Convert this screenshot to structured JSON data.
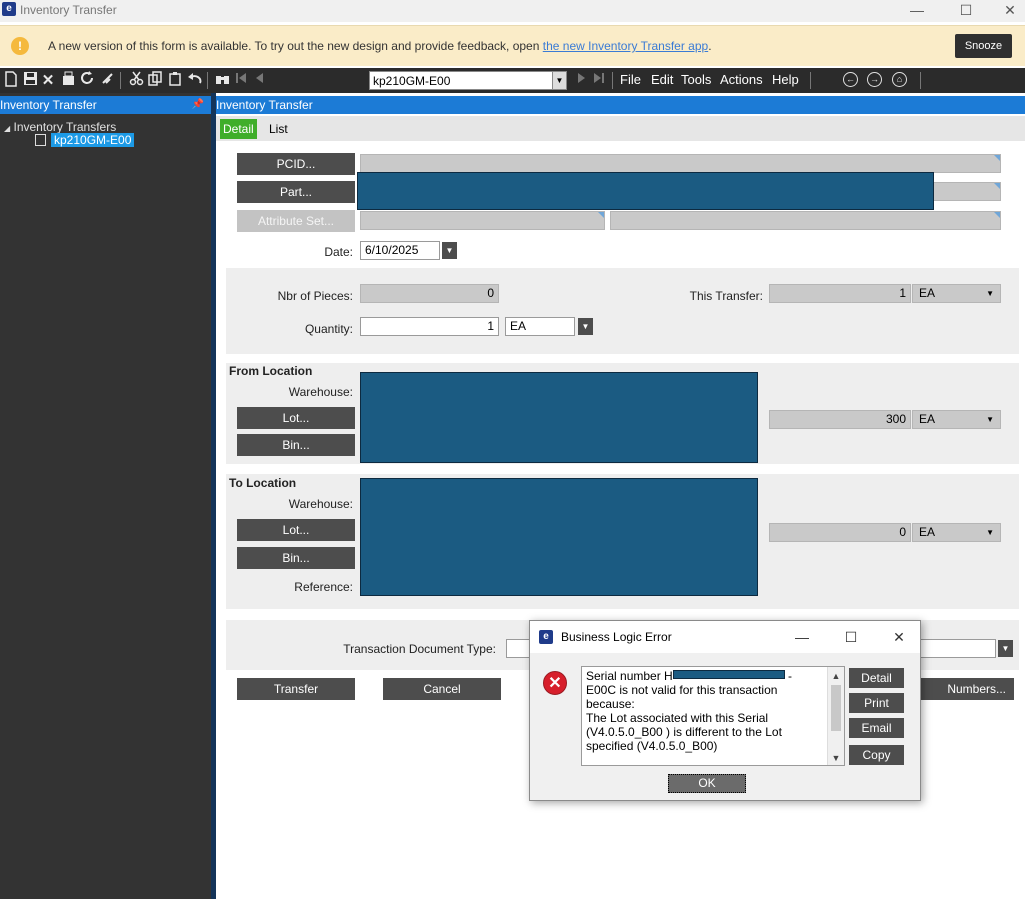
{
  "window": {
    "title": "Inventory Transfer",
    "icon_glyph": "e",
    "minimize": "—",
    "maximize": "☐",
    "close": "✕"
  },
  "banner": {
    "message": "A new version of this form is available. To try out the new design and provide feedback, open ",
    "link": "the new Inventory Transfer app",
    "link_suffix": ".",
    "snooze": "Snooze",
    "warn_glyph": "!"
  },
  "toolbar": {
    "record_value": "kp210GM-E00",
    "menus": [
      "File",
      "Edit",
      "Tools",
      "Actions",
      "Help"
    ],
    "icons": [
      "new-icon",
      "save-icon",
      "delete-icon",
      "clear-icon",
      "refresh-icon",
      "clear-all-icon",
      "cut-icon",
      "copy-icon",
      "paste-icon",
      "undo-icon",
      "search-icon",
      "first-record-icon",
      "previous-record-icon",
      "next-record-icon",
      "last-record-icon",
      "back-icon",
      "forward-icon",
      "home-icon"
    ]
  },
  "tree_pane": {
    "header": "Inventory Transfer",
    "root": "Inventory Transfers",
    "child": "kp210GM-E00"
  },
  "main": {
    "header": "Inventory Transfer",
    "tabs": [
      "Detail",
      "List"
    ],
    "buttons": {
      "pcid": "PCID...",
      "part": "Part...",
      "attribute_set": "Attribute Set...",
      "from_lot": "Lot...",
      "from_bin": "Bin...",
      "to_lot": "Lot...",
      "to_bin": "Bin...",
      "transfer": "Transfer",
      "cancel": "Cancel",
      "serial_numbers": "Numbers..."
    },
    "date_label": "Date:",
    "date_value": "6/10/2025",
    "nbr_pieces_label": "Nbr of Pieces:",
    "nbr_pieces_value": "0",
    "this_transfer_label": "This Transfer:",
    "this_transfer_value": "1",
    "this_transfer_uom": "EA",
    "quantity_label": "Quantity:",
    "quantity_value": "1",
    "quantity_uom": "EA",
    "from_location": {
      "title": "From Location",
      "warehouse_label": "Warehouse:",
      "onhand_value": "300",
      "onhand_uom": "EA"
    },
    "to_location": {
      "title": "To Location",
      "warehouse_label": "Warehouse:",
      "onhand_value": "0",
      "onhand_uom": "EA",
      "reference_label": "Reference:"
    },
    "transaction_doc_type_label": "Transaction Document Type:"
  },
  "dialog": {
    "title": "Business Logic Error",
    "message_prefix": "Serial number H",
    "message_after_redact": "-",
    "message_lines": [
      "E00C is not valid for this transaction",
      "because:",
      "The Lot associated with this Serial",
      "(V4.0.5.0_B00 ) is different to the Lot",
      "specified (V4.0.5.0_B00)"
    ],
    "buttons": [
      "Detail",
      "Print",
      "Email",
      "Copy"
    ],
    "ok": "OK",
    "error_glyph": "✕"
  }
}
